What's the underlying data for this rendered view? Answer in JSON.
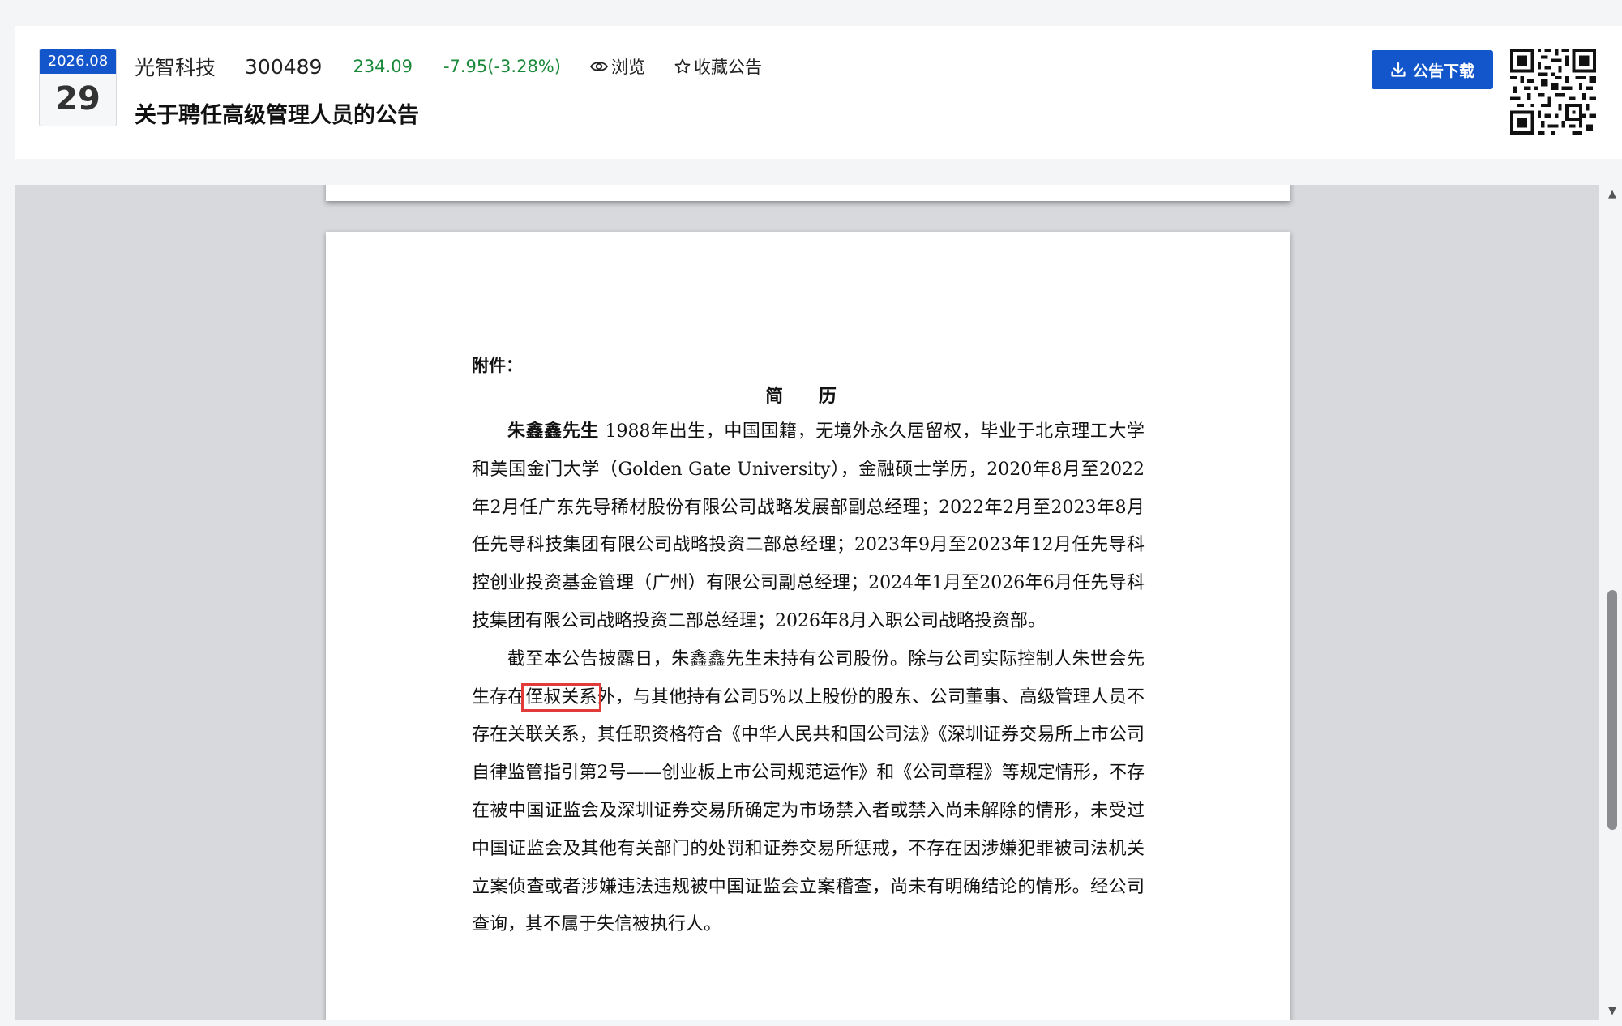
{
  "header": {
    "date_month": "2026.08",
    "date_day": "29",
    "stock_name": "光智科技",
    "stock_code": "300489",
    "price": "234.09",
    "change": "-7.95(-3.28%)",
    "browse_label": "浏览",
    "favorite_label": "收藏公告",
    "title": "关于聘任高级管理人员的公告",
    "download_label": "公告下载"
  },
  "document": {
    "attachment_label": "附件：",
    "resume_title": "简 历",
    "person_name": "朱鑫鑫先生",
    "para1_rest": " 1988年出生，中国国籍，无境外永久居留权，毕业于北京理工大学和美国金门大学（Golden Gate University），金融硕士学历，2020年8月至2022年2月任广东先导稀材股份有限公司战略发展部副总经理；2022年2月至2023年8月任先导科技集团有限公司战略投资二部总经理；2023年9月至2023年12月任先导科控创业投资基金管理（广州）有限公司副总经理；2024年1月至2026年6月任先导科技集团有限公司战略投资二部总经理；2026年8月入职公司战略投资部。",
    "para2_before": "截至本公告披露日，朱鑫鑫先生未持有公司股份。除与公司实际控制人朱世会先生存在",
    "para2_highlight": "侄叔关系",
    "para2_after": "外，与其他持有公司5%以上股份的股东、公司董事、高级管理人员不存在关联关系，其任职资格符合《中华人民共和国公司法》《深圳证券交易所上市公司自律监管指引第2号——创业板上市公司规范运作》和《公司章程》等规定情形，不存在被中国证监会及深圳证券交易所确定为市场禁入者或禁入尚未解除的情形，未受过中国证监会及其他有关部门的处罚和证券交易所惩戒，不存在因涉嫌犯罪被司法机关立案侦查或者涉嫌违法违规被中国证监会立案稽查，尚未有明确结论的情形。经公司查询，其不属于失信被执行人。"
  },
  "colors": {
    "accent": "#1356cc",
    "stock_change": "#1a8a3a",
    "highlight_box": "#e23b3b"
  },
  "icons": {
    "browse": "eye-icon",
    "favorite": "star-outline-icon",
    "download": "download-icon",
    "qr": "qr-code-icon"
  }
}
